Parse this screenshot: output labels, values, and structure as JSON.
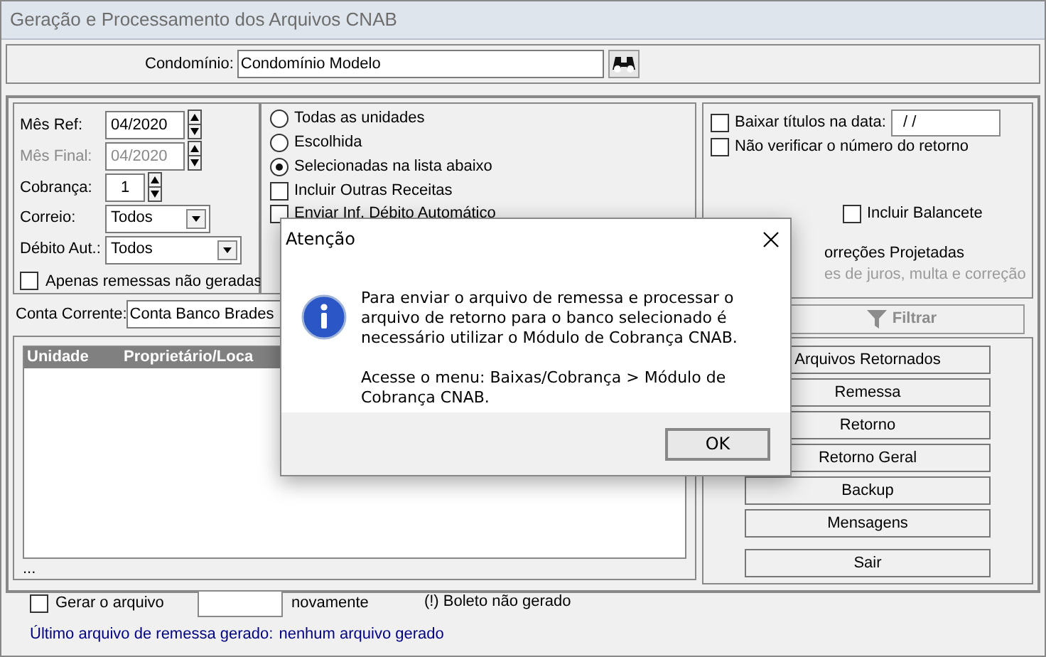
{
  "window": {
    "title": "Geração e Processamento dos Arquivos CNAB"
  },
  "condominio": {
    "label": "Condomínio:",
    "value": "Condomínio Modelo"
  },
  "filters": [
    {
      "kind": "spin",
      "label": "Mês Ref:",
      "value": "04/2020",
      "disabled": false
    },
    {
      "kind": "spin",
      "label": "Mês Final:",
      "value": "04/2020",
      "disabled": true
    },
    {
      "kind": "spin-small",
      "label": "Cobrança:",
      "value": "1",
      "disabled": false
    },
    {
      "kind": "combo",
      "label": "Correio:",
      "value": "Todos",
      "disabled": false
    },
    {
      "kind": "combo-wide",
      "label": "Débito Aut.:",
      "value": "Todos",
      "disabled": false
    }
  ],
  "apenas": {
    "label": "Apenas remessas não geradas",
    "checked": false
  },
  "units": [
    {
      "label": "Todas as unidades",
      "selected": false
    },
    {
      "label": "Escolhida",
      "selected": false
    },
    {
      "label": "Selecionadas na lista abaixo",
      "selected": true
    }
  ],
  "unit_checks": [
    {
      "label": "Incluir Outras Receitas",
      "checked": false
    },
    {
      "label": "Enviar Inf. Débito Automático",
      "checked": false
    }
  ],
  "right_options": {
    "baixar": {
      "label": "Baixar títulos na data:",
      "checked": false,
      "value": " / /"
    },
    "nao_verificar": {
      "label": "Não verificar o número do retorno",
      "checked": false
    },
    "balancete": {
      "label": "Incluir Balancete",
      "checked": false
    },
    "correcoes": "orreções Projetadas",
    "correcoes_hint": "es de juros, multa e correção"
  },
  "filter_button": {
    "label": "Filtrar",
    "disabled": true
  },
  "conta_corrente": {
    "label": "Conta Corrente:",
    "value": "Conta Banco Brades"
  },
  "table": {
    "columns": [
      "Unidade",
      "Proprietário/Loca"
    ],
    "footer": "..."
  },
  "buttons": [
    "Arquivos Retornados",
    "Remessa",
    "Retorno",
    "Retorno Geral",
    "Backup",
    "Mensagens",
    "Sair"
  ],
  "bottom": {
    "gerar": {
      "label": "Gerar o arquivo",
      "checked": false
    },
    "after": "novamente",
    "note": "(!) Boleto não gerado",
    "last_label": "Último arquivo de remessa gerado:",
    "last_value": "nenhum arquivo gerado"
  },
  "dialog": {
    "title": "Atenção",
    "paragraphs": [
      "Para enviar o arquivo de remessa e processar o arquivo de retorno para o banco selecionado é necessário utilizar o Módulo de Cobrança CNAB.",
      "Acesse o menu: Baixas/Cobrança > Módulo de Cobrança CNAB."
    ],
    "ok": "OK"
  }
}
